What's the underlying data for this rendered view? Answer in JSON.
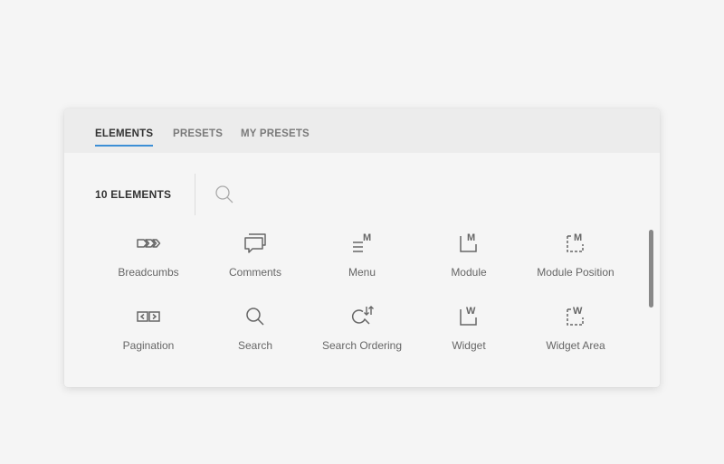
{
  "tabs": [
    {
      "label": "ELEMENTS"
    },
    {
      "label": "PRESETS"
    },
    {
      "label": "MY PRESETS"
    }
  ],
  "toolbar": {
    "count_label": "10 ELEMENTS",
    "search_placeholder": ""
  },
  "elements": [
    {
      "label": "Breadcumbs",
      "icon": "breadcrumbs-icon"
    },
    {
      "label": "Comments",
      "icon": "comments-icon"
    },
    {
      "label": "Menu",
      "icon": "menu-icon"
    },
    {
      "label": "Module",
      "icon": "module-icon"
    },
    {
      "label": "Module Position",
      "icon": "module-position-icon"
    },
    {
      "label": "Pagination",
      "icon": "pagination-icon"
    },
    {
      "label": "Search",
      "icon": "search-icon"
    },
    {
      "label": "Search Ordering",
      "icon": "search-ordering-icon"
    },
    {
      "label": "Widget",
      "icon": "widget-icon"
    },
    {
      "label": "Widget Area",
      "icon": "widget-area-icon"
    }
  ],
  "colors": {
    "accent": "#3d8fd6",
    "icon": "#666666",
    "text": "#333333"
  }
}
